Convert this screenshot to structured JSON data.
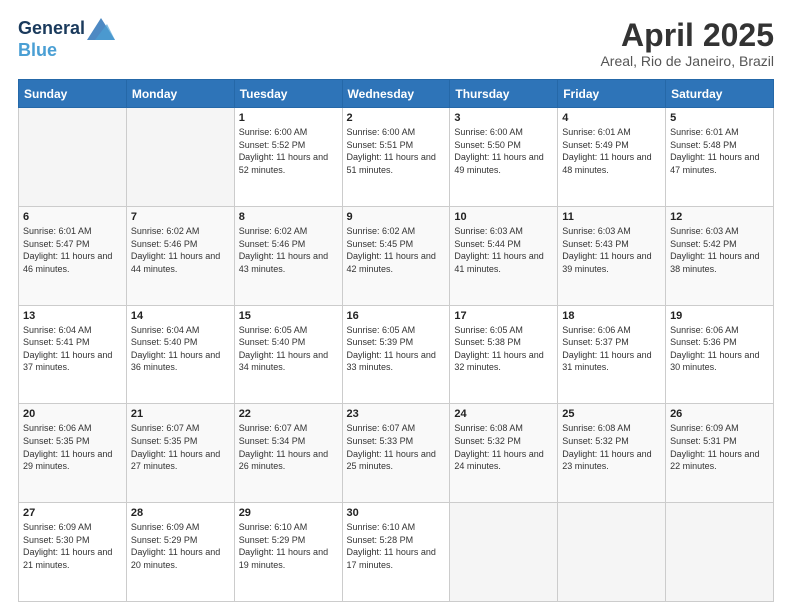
{
  "header": {
    "logo_line1": "General",
    "logo_line2": "Blue",
    "month": "April 2025",
    "location": "Areal, Rio de Janeiro, Brazil"
  },
  "days_of_week": [
    "Sunday",
    "Monday",
    "Tuesday",
    "Wednesday",
    "Thursday",
    "Friday",
    "Saturday"
  ],
  "weeks": [
    [
      {
        "day": "",
        "info": ""
      },
      {
        "day": "",
        "info": ""
      },
      {
        "day": "1",
        "info": "Sunrise: 6:00 AM\nSunset: 5:52 PM\nDaylight: 11 hours and 52 minutes."
      },
      {
        "day": "2",
        "info": "Sunrise: 6:00 AM\nSunset: 5:51 PM\nDaylight: 11 hours and 51 minutes."
      },
      {
        "day": "3",
        "info": "Sunrise: 6:00 AM\nSunset: 5:50 PM\nDaylight: 11 hours and 49 minutes."
      },
      {
        "day": "4",
        "info": "Sunrise: 6:01 AM\nSunset: 5:49 PM\nDaylight: 11 hours and 48 minutes."
      },
      {
        "day": "5",
        "info": "Sunrise: 6:01 AM\nSunset: 5:48 PM\nDaylight: 11 hours and 47 minutes."
      }
    ],
    [
      {
        "day": "6",
        "info": "Sunrise: 6:01 AM\nSunset: 5:47 PM\nDaylight: 11 hours and 46 minutes."
      },
      {
        "day": "7",
        "info": "Sunrise: 6:02 AM\nSunset: 5:46 PM\nDaylight: 11 hours and 44 minutes."
      },
      {
        "day": "8",
        "info": "Sunrise: 6:02 AM\nSunset: 5:46 PM\nDaylight: 11 hours and 43 minutes."
      },
      {
        "day": "9",
        "info": "Sunrise: 6:02 AM\nSunset: 5:45 PM\nDaylight: 11 hours and 42 minutes."
      },
      {
        "day": "10",
        "info": "Sunrise: 6:03 AM\nSunset: 5:44 PM\nDaylight: 11 hours and 41 minutes."
      },
      {
        "day": "11",
        "info": "Sunrise: 6:03 AM\nSunset: 5:43 PM\nDaylight: 11 hours and 39 minutes."
      },
      {
        "day": "12",
        "info": "Sunrise: 6:03 AM\nSunset: 5:42 PM\nDaylight: 11 hours and 38 minutes."
      }
    ],
    [
      {
        "day": "13",
        "info": "Sunrise: 6:04 AM\nSunset: 5:41 PM\nDaylight: 11 hours and 37 minutes."
      },
      {
        "day": "14",
        "info": "Sunrise: 6:04 AM\nSunset: 5:40 PM\nDaylight: 11 hours and 36 minutes."
      },
      {
        "day": "15",
        "info": "Sunrise: 6:05 AM\nSunset: 5:40 PM\nDaylight: 11 hours and 34 minutes."
      },
      {
        "day": "16",
        "info": "Sunrise: 6:05 AM\nSunset: 5:39 PM\nDaylight: 11 hours and 33 minutes."
      },
      {
        "day": "17",
        "info": "Sunrise: 6:05 AM\nSunset: 5:38 PM\nDaylight: 11 hours and 32 minutes."
      },
      {
        "day": "18",
        "info": "Sunrise: 6:06 AM\nSunset: 5:37 PM\nDaylight: 11 hours and 31 minutes."
      },
      {
        "day": "19",
        "info": "Sunrise: 6:06 AM\nSunset: 5:36 PM\nDaylight: 11 hours and 30 minutes."
      }
    ],
    [
      {
        "day": "20",
        "info": "Sunrise: 6:06 AM\nSunset: 5:35 PM\nDaylight: 11 hours and 29 minutes."
      },
      {
        "day": "21",
        "info": "Sunrise: 6:07 AM\nSunset: 5:35 PM\nDaylight: 11 hours and 27 minutes."
      },
      {
        "day": "22",
        "info": "Sunrise: 6:07 AM\nSunset: 5:34 PM\nDaylight: 11 hours and 26 minutes."
      },
      {
        "day": "23",
        "info": "Sunrise: 6:07 AM\nSunset: 5:33 PM\nDaylight: 11 hours and 25 minutes."
      },
      {
        "day": "24",
        "info": "Sunrise: 6:08 AM\nSunset: 5:32 PM\nDaylight: 11 hours and 24 minutes."
      },
      {
        "day": "25",
        "info": "Sunrise: 6:08 AM\nSunset: 5:32 PM\nDaylight: 11 hours and 23 minutes."
      },
      {
        "day": "26",
        "info": "Sunrise: 6:09 AM\nSunset: 5:31 PM\nDaylight: 11 hours and 22 minutes."
      }
    ],
    [
      {
        "day": "27",
        "info": "Sunrise: 6:09 AM\nSunset: 5:30 PM\nDaylight: 11 hours and 21 minutes."
      },
      {
        "day": "28",
        "info": "Sunrise: 6:09 AM\nSunset: 5:29 PM\nDaylight: 11 hours and 20 minutes."
      },
      {
        "day": "29",
        "info": "Sunrise: 6:10 AM\nSunset: 5:29 PM\nDaylight: 11 hours and 19 minutes."
      },
      {
        "day": "30",
        "info": "Sunrise: 6:10 AM\nSunset: 5:28 PM\nDaylight: 11 hours and 17 minutes."
      },
      {
        "day": "",
        "info": ""
      },
      {
        "day": "",
        "info": ""
      },
      {
        "day": "",
        "info": ""
      }
    ]
  ]
}
